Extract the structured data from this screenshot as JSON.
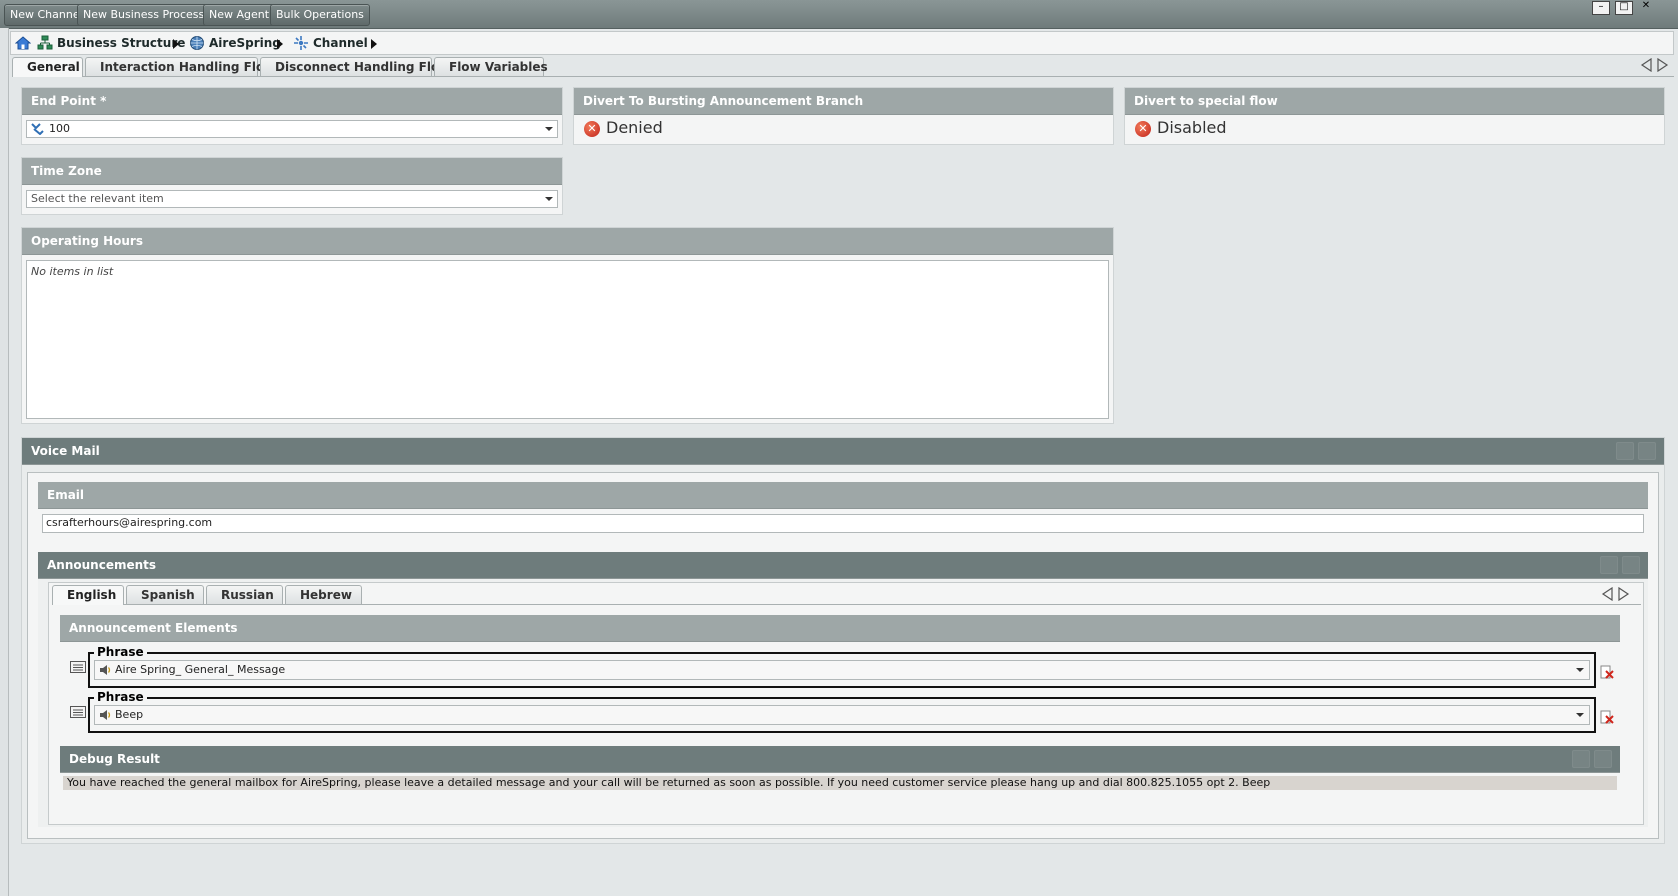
{
  "toolbar": {
    "new_channel": "New Channel",
    "new_business_process": "New Business Process",
    "new_agent": "New Agent",
    "bulk_operations": "Bulk Operations"
  },
  "window": {
    "minimize": "–",
    "maximize": "□",
    "close": "✕"
  },
  "breadcrumb": {
    "items": [
      "Business Structure",
      "AireSpring",
      "Channel"
    ]
  },
  "tabs": [
    "General",
    "Interaction Handling Flow",
    "Disconnect Handling Flow",
    "Flow Variables"
  ],
  "end_point": {
    "label": "End Point *",
    "value": "100"
  },
  "divert_bursting": {
    "label": "Divert To Bursting Announcement Branch",
    "status": "Denied"
  },
  "divert_special": {
    "label": "Divert to special flow",
    "status": "Disabled"
  },
  "time_zone": {
    "label": "Time Zone",
    "placeholder": "Select the relevant item"
  },
  "operating_hours": {
    "label": "Operating Hours",
    "empty": "No items in list"
  },
  "voice_mail": {
    "label": "Voice Mail",
    "email": {
      "label": "Email",
      "value": "csrafterhours@airespring.com"
    },
    "announcements": {
      "label": "Announcements",
      "languages": [
        "English",
        "Spanish",
        "Russian",
        "Hebrew"
      ],
      "elements_label": "Announcement Elements",
      "phrases": [
        {
          "legend": "Phrase",
          "value": "Aire Spring_ General_ Message"
        },
        {
          "legend": "Phrase",
          "value": "Beep"
        }
      ],
      "debug": {
        "label": "Debug Result",
        "text": "You have reached the general mailbox for AireSpring, please leave a detailed message and your call will be returned as soon as possible. If you need customer service please hang up and dial 800.825.1055 opt 2. Beep"
      }
    }
  },
  "colors": {
    "header_light": "#9ea7a7",
    "header_dark": "#6e7c7c",
    "deny_red": "#c1241b",
    "background": "#e3e7e8"
  }
}
